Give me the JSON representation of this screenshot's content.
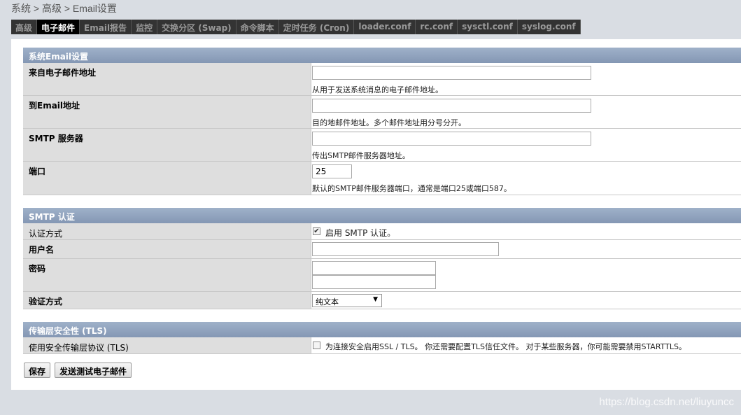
{
  "breadcrumb": "系统 > 高级 > Email设置",
  "tabs": [
    "高级",
    "电子邮件",
    "Email报告",
    "监控",
    "交换分区 (Swap)",
    "命令脚本",
    "定时任务 (Cron)",
    "loader.conf",
    "rc.conf",
    "sysctl.conf",
    "syslog.conf"
  ],
  "active_tab": "电子邮件",
  "section_email": {
    "title": "系统Email设置",
    "from_label": "来自电子邮件地址",
    "from_value": "",
    "from_hint": "从用于发送系统消息的电子邮件地址。",
    "to_label": "到Email地址",
    "to_value": "",
    "to_hint": "目的地邮件地址。多个邮件地址用分号分开。",
    "smtp_label": "SMTP 服务器",
    "smtp_value": "",
    "smtp_hint": "传出SMTP邮件服务器地址。",
    "port_label": "端口",
    "port_value": "25",
    "port_hint": "默认的SMTP邮件服务器端口，通常是端口25或端口587。"
  },
  "section_auth": {
    "title": "SMTP 认证",
    "method_label": "认证方式",
    "method_checkbox_label": "启用 SMTP 认证。",
    "method_checked": true,
    "username_label": "用户名",
    "username_value": "",
    "password_label": "密码",
    "verify_label": "验证方式",
    "verify_selected": "纯文本"
  },
  "section_tls": {
    "title": "传输层安全性 (TLS)",
    "tls_label": "使用安全传输层协议 (TLS)",
    "tls_checkbox_label": "为连接安全启用SSL / TLS。 你还需要配置TLS信任文件。 对于某些服务器，你可能需要禁用STARTTLS。",
    "tls_checked": false
  },
  "buttons": {
    "save": "保存",
    "send_test": "发送测试电子邮件"
  },
  "watermark": "https://blog.csdn.net/liuyuncc"
}
